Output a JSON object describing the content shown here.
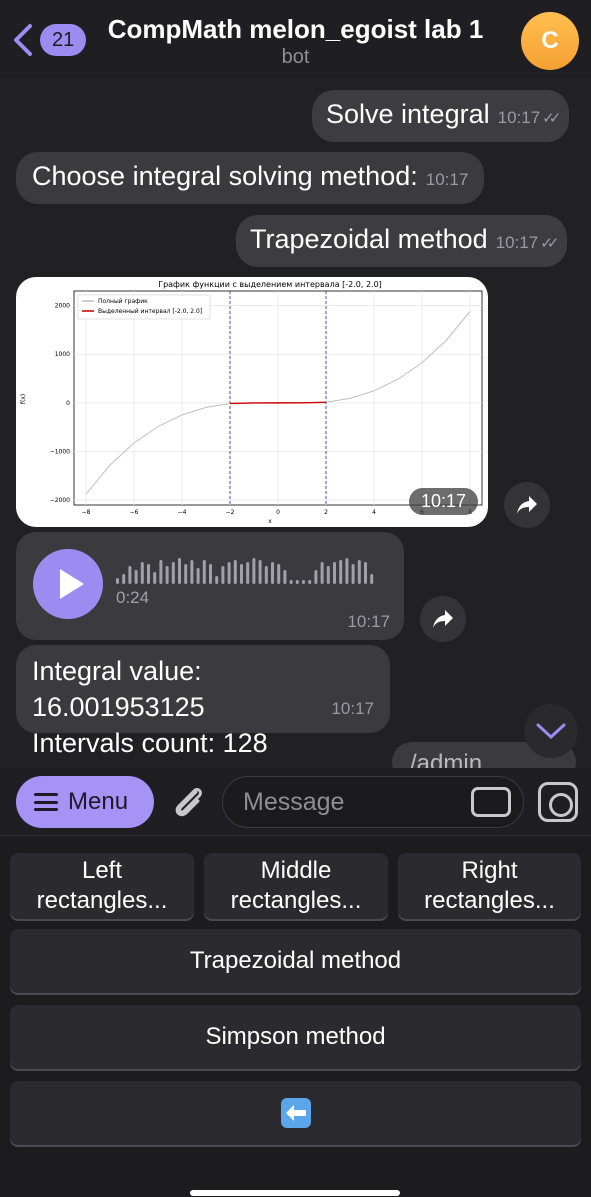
{
  "header": {
    "back_badge": "21",
    "title": "CompMath melon_egoist lab 1",
    "subtitle": "bot",
    "avatar_letter": "C"
  },
  "messages": {
    "m1": {
      "text": "Solve integral",
      "time": "10:17"
    },
    "m2": {
      "text": "Choose integral solving method:",
      "time": "10:17"
    },
    "m3": {
      "text": "Trapezoidal method",
      "time": "10:17"
    },
    "photo": {
      "time": "10:17"
    },
    "voice": {
      "duration": "0:24",
      "time": "10:17"
    },
    "result": {
      "line1": "Integral value: 16.001953125",
      "line2": "Intervals count: 128",
      "time": "10:17"
    },
    "peek_text": "/admin"
  },
  "chart_data": {
    "type": "line",
    "title": "График функции с выделением интервала [-2.0, 2.0]",
    "xlabel": "x",
    "ylabel": "f(x)",
    "xlim": [
      -8.5,
      8.5
    ],
    "ylim": [
      -2100,
      2300
    ],
    "xticks": [
      -8,
      -6,
      -4,
      -2,
      0,
      2,
      4,
      6,
      8
    ],
    "yticks": [
      -2000,
      -1000,
      0,
      1000,
      2000
    ],
    "ytick_labels": [
      "−2000",
      "−1000",
      "0",
      "1000",
      "2000"
    ],
    "grid": true,
    "legend_position": "top-left",
    "series": [
      {
        "name": "Полный график",
        "color": "#bfbfbf",
        "x": [
          -8,
          -7,
          -6,
          -5,
          -4,
          -3,
          -2,
          -1,
          0,
          1,
          2,
          3,
          4,
          5,
          6,
          7,
          8
        ],
        "values": [
          -1877,
          -1280,
          -824,
          -486,
          -248,
          -93,
          -12,
          -2,
          0,
          2,
          12,
          93,
          248,
          486,
          824,
          1280,
          1877
        ]
      },
      {
        "name": "Выделенный интервал [-2.0, 2.0]",
        "color": "#cc0000",
        "x": [
          -2,
          -1,
          0,
          1,
          2
        ],
        "values": [
          -12,
          -2,
          0,
          2,
          12
        ]
      }
    ],
    "vlines": [
      {
        "x": -2,
        "color": "#2222cc"
      },
      {
        "x": 2,
        "color": "#2222cc"
      }
    ]
  },
  "input": {
    "menu_label": "Menu",
    "placeholder": "Message"
  },
  "keyboard": {
    "row1": [
      "Left\nrectangles...",
      "Middle\nrectangles...",
      "Right\nrectangles..."
    ],
    "left": "Left",
    "left2": "rectangles...",
    "middle": "Middle",
    "middle2": "rectangles...",
    "right": "Right",
    "right2": "rectangles...",
    "trapezoidal": "Trapezoidal method",
    "simpson": "Simpson method",
    "back_emoji": "⬅️"
  },
  "colors": {
    "accent": "#9c8cf2",
    "avatar": "#f5a133",
    "bubble": "#3a3a3f"
  }
}
